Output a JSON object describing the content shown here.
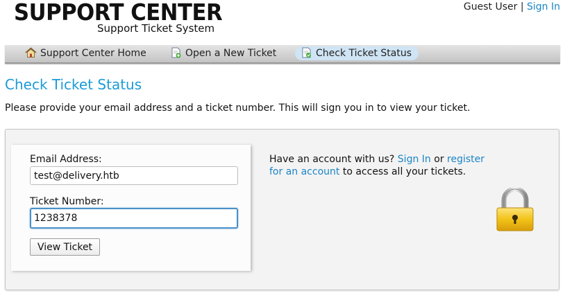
{
  "header": {
    "logo_title": "SUPPORT CENTER",
    "logo_subtitle": "Support Ticket System",
    "user_label": "Guest User",
    "separator": "|",
    "sign_in_label": "Sign In"
  },
  "nav": {
    "items": [
      {
        "label": "Support Center Home",
        "icon": "home-icon"
      },
      {
        "label": "Open a New Ticket",
        "icon": "new-ticket-icon"
      },
      {
        "label": "Check Ticket Status",
        "icon": "ticket-status-icon",
        "active": true
      }
    ]
  },
  "page": {
    "title": "Check Ticket Status",
    "intro": "Please provide your email address and a ticket number. This will sign you in to view your ticket."
  },
  "form": {
    "email_label": "Email Address:",
    "email_value": "test@delivery.htb",
    "ticket_label": "Ticket Number:",
    "ticket_value": "1238378",
    "submit_label": "View Ticket"
  },
  "info": {
    "text_1": "Have an account with us?",
    "sign_in_link": "Sign In",
    "text_2": "or",
    "register_link": "register for an account",
    "text_3": "to access all your tickets.",
    "icon": "padlock-icon"
  },
  "colors": {
    "link": "#1b85c7",
    "title": "#1b9bd7",
    "nav_active": "#cfe4f4",
    "panel_bg": "#f3f3f3",
    "input_focus": "#4a90c8",
    "lock_body": "#f2c318"
  }
}
